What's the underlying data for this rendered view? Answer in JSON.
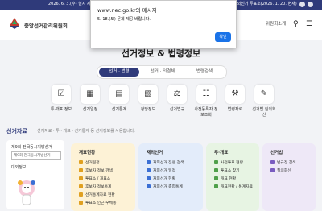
{
  "topbar": {
    "ticker_left": "2026. 6. 3.(수) 실시 제9회 전국동시지방선거",
    "ticker_right": "재외선거 투표소(2026. 1. 20. 현재)"
  },
  "header": {
    "logo_text": "중앙선거관리위원회",
    "nav_right": "위원회소개"
  },
  "page": {
    "title": "선거정보 & 법령정보"
  },
  "tabs": [
    {
      "label": "선거 · 법령",
      "active": true
    },
    {
      "label": "선거 · 의결체",
      "active": false
    },
    {
      "label": "법령검색",
      "active": false
    }
  ],
  "quick_icons": [
    {
      "label": "투·개표 정보",
      "icon": "ballot-icon"
    },
    {
      "label": "선거일정",
      "icon": "calendar-icon"
    },
    {
      "label": "선거통계",
      "icon": "chart-icon"
    },
    {
      "label": "정당정보",
      "icon": "book-icon"
    },
    {
      "label": "선거법규",
      "icon": "law-icon"
    },
    {
      "label": "사전등록자 정보조회",
      "icon": "id-icon"
    },
    {
      "label": "법령자료",
      "icon": "gavel-icon"
    },
    {
      "label": "선거법 질의회신",
      "icon": "qa-icon"
    }
  ],
  "section": {
    "title": "선거자료",
    "subtitle": "선거자료 · 투 · 개표 · 선거통계 등 선거정보를 사용합니다."
  },
  "left_card": {
    "heading": "제9회 전국동시지방선거",
    "select_value": "제9회 전국동시지방선거",
    "extra": "대외정보"
  },
  "cards": [
    {
      "heading": "개표현황",
      "bg": "#fdf2d6",
      "bullet": "#e0a020",
      "items": [
        "선거일정",
        "후보자 정보 검색",
        "투표소 / 개표소",
        "후보자 정보통계",
        "선거통계자료 현황",
        "투표소 인근 우체통"
      ]
    },
    {
      "heading": "재외선거",
      "bg": "#e3ecfa",
      "bullet": "#3b6fd4",
      "items": [
        "재외선거 전용 검색",
        "재외선거 일정",
        "재외선거 현황",
        "재외선거 종합통계"
      ]
    },
    {
      "heading": "투·개표",
      "bg": "#e7f4e3",
      "bullet": "#4fa04a",
      "items": [
        "사전투표 현황",
        "투표소 찾기",
        "개표 현황",
        "개표현황 / 통계자료"
      ]
    },
    {
      "heading": "선거법",
      "bg": "#eee8f7",
      "bullet": "#7a5cc0",
      "items": [
        "법규정 검색",
        "질의회신"
      ]
    }
  ],
  "dialog": {
    "title": "www.nec.go.kr의 메시지",
    "message": "5. 18.(토) 문제 제공 바랍니다.",
    "ok_label": "확인"
  }
}
